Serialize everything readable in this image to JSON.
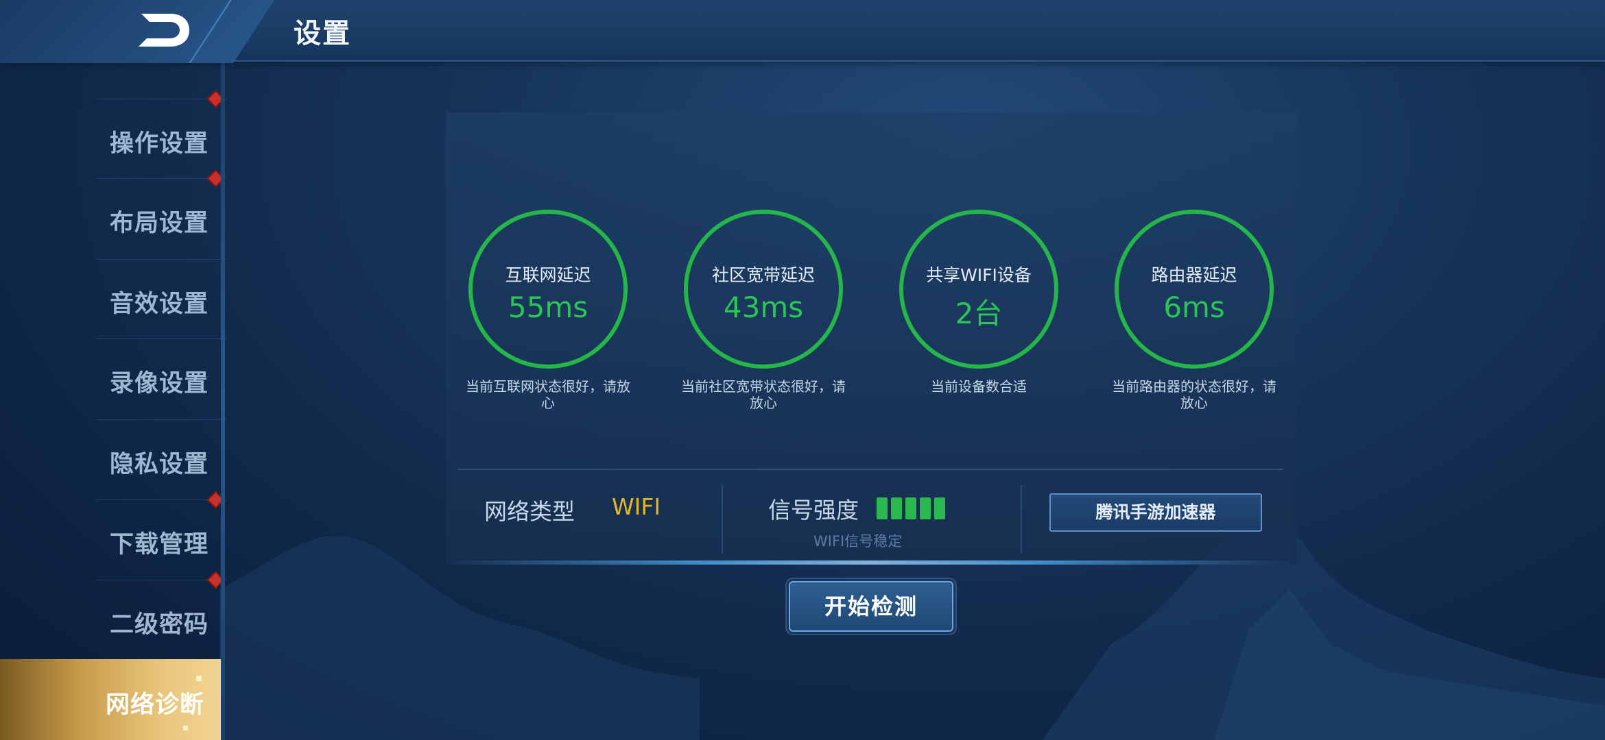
{
  "header": {
    "title": "设置"
  },
  "sidebar": {
    "items": [
      {
        "label": "操作设置",
        "badge": true
      },
      {
        "label": "布局设置",
        "badge": true
      },
      {
        "label": "音效设置",
        "badge": false
      },
      {
        "label": "录像设置",
        "badge": false
      },
      {
        "label": "隐私设置",
        "badge": false
      },
      {
        "label": "下载管理",
        "badge": true
      },
      {
        "label": "二级密码",
        "badge": true
      },
      {
        "label": "网络诊断",
        "badge": false,
        "active": true
      }
    ]
  },
  "diagnostics": {
    "gauges": [
      {
        "title": "互联网延迟",
        "value": "55ms",
        "desc": "当前互联网状态很好，请放心"
      },
      {
        "title": "社区宽带延迟",
        "value": "43ms",
        "desc": "当前社区宽带状态很好，请放心"
      },
      {
        "title": "共享WIFI设备",
        "value": "2台",
        "desc": "当前设备数合适"
      },
      {
        "title": "路由器延迟",
        "value": "6ms",
        "desc": "当前路由器的状态很好，请放心"
      }
    ],
    "network_type_label": "网络类型",
    "network_type_value": "WIFI",
    "signal_label": "信号强度",
    "signal_bars": 5,
    "signal_note": "WIFI信号稳定",
    "accelerator_button": "腾讯手游加速器",
    "start_button": "开始检测"
  },
  "colors": {
    "good": "#25b64a",
    "wifi_accent": "#e7b52c",
    "active_tab": "#d4ad62",
    "badge": "#c9302c"
  }
}
